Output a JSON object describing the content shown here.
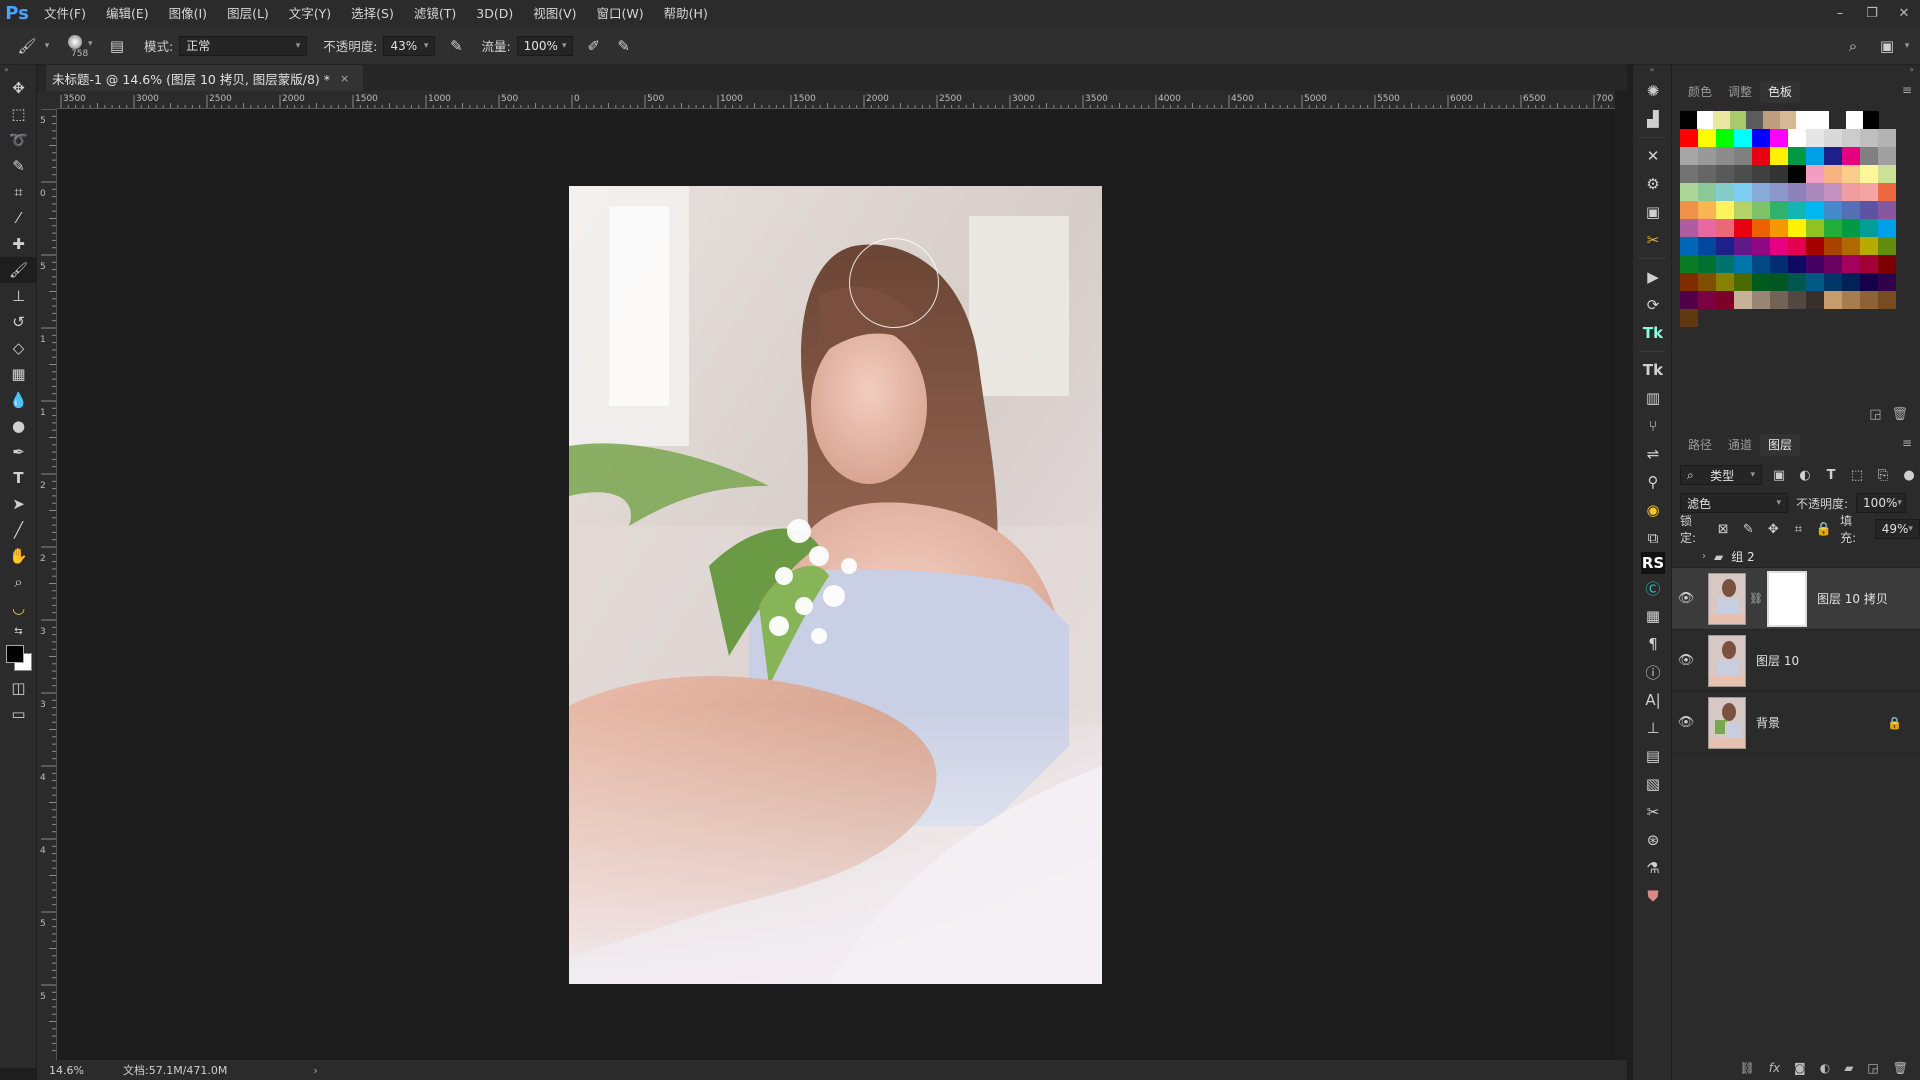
{
  "app": {
    "logo": "Ps"
  },
  "menu": [
    "文件(F)",
    "编辑(E)",
    "图像(I)",
    "图层(L)",
    "文字(Y)",
    "选择(S)",
    "滤镜(T)",
    "3D(D)",
    "视图(V)",
    "窗口(W)",
    "帮助(H)"
  ],
  "options": {
    "brush_size": "758",
    "mode_label": "模式:",
    "mode_value": "正常",
    "opacity_label": "不透明度:",
    "opacity_value": "43%",
    "flow_label": "流量:",
    "flow_value": "100%"
  },
  "document": {
    "tab_title": "未标题-1 @ 14.6% (图层 10 拷贝, 图层蒙版/8) *",
    "close": "×"
  },
  "ruler_h": [
    "3500",
    "3000",
    "2500",
    "2000",
    "1500",
    "1000",
    "500",
    "0",
    "500",
    "1000",
    "1500",
    "2000",
    "2500",
    "3000",
    "3500",
    "4000",
    "4500",
    "5000",
    "5500",
    "6000",
    "6500",
    "700"
  ],
  "ruler_v": [
    "5",
    "0",
    "5",
    "1",
    "1",
    "2",
    "2",
    "3",
    "3",
    "4",
    "4",
    "5",
    "5"
  ],
  "status": {
    "zoom": "14.6%",
    "doc_info": "文档:57.1M/471.0M",
    "chevron": "›"
  },
  "panels": {
    "top_tabs": [
      "颜色",
      "调整",
      "色板"
    ],
    "top_active": "色板",
    "layer_tabs": [
      "路径",
      "通道",
      "图层"
    ],
    "layer_active": "图层",
    "filter_kind": "类型",
    "blend_mode": "滤色",
    "opacity_label": "不透明度:",
    "opacity_value": "100%",
    "lock_label": "锁定:",
    "fill_label": "填充:",
    "fill_value": "49%",
    "group_name": "组 2",
    "layers": [
      {
        "name": "图层 10 拷贝",
        "has_mask": true,
        "selected": true
      },
      {
        "name": "图层 10",
        "has_mask": false,
        "selected": false
      },
      {
        "name": "背景",
        "has_mask": false,
        "selected": false,
        "locked": true
      }
    ]
  },
  "swatch_colors": [
    [
      "#000000",
      "#ffffff",
      "#e8e8a0",
      "#a8cc6c",
      "#5c5c5c",
      "#bd9f80",
      "#d6b896",
      "#ffffff",
      "#ffffff",
      "#2b2b2b",
      "#ffffff",
      "#000000",
      "#2b2b2b"
    ],
    [
      "#ff0000",
      "#ffff00",
      "#00ff00",
      "#00ffff",
      "#0000ff",
      "#ff00ff",
      "#ffffff",
      "#e6e6e6",
      "#d9d9d9",
      "#cccccc",
      "#bfbfbf",
      "#b3b3b3"
    ],
    [
      "#a6a6a6",
      "#999999",
      "#8c8c8c",
      "#808080",
      "#e60012",
      "#fff100",
      "#009944",
      "#00a0e9",
      "#1d2088",
      "#e4007f",
      "#808080",
      "#a0a0a0"
    ],
    [
      "#737373",
      "#666666",
      "#595959",
      "#4d4d4d",
      "#404040",
      "#333333",
      "#000000",
      "#f19ec2",
      "#f6b37f",
      "#facd89",
      "#fff799",
      "#cce198"
    ],
    [
      "#acd598",
      "#89c997",
      "#84ccc9",
      "#7ecef4",
      "#88abda",
      "#8c97cb",
      "#8f82bc",
      "#aa89bd",
      "#c490bf",
      "#f29c9f",
      "#f5a4a4",
      "#ec6941"
    ],
    [
      "#f19149",
      "#f8b551",
      "#fff45c",
      "#b3d465",
      "#80c269",
      "#32b16c",
      "#13b5b1",
      "#00b7ee",
      "#448aca",
      "#556fb5",
      "#5f52a0",
      "#8957a1"
    ],
    [
      "#ae5da1",
      "#ea68a2",
      "#eb6877",
      "#e60012",
      "#eb6100",
      "#f39800",
      "#fff100",
      "#8fc31f",
      "#22ac38",
      "#009944",
      "#009e96",
      "#00a0e9"
    ],
    [
      "#0068b7",
      "#00479d",
      "#1d2088",
      "#601986",
      "#920783",
      "#e4007f",
      "#e5004f",
      "#a40000",
      "#a84200",
      "#ac6a00",
      "#b7aa00",
      "#638c0b"
    ],
    [
      "#097c25",
      "#007130",
      "#00736d",
      "#0075a9",
      "#004986",
      "#002e73",
      "#100964",
      "#440062",
      "#6a005f",
      "#a4005b",
      "#a40035",
      "#7d0000"
    ],
    [
      "#7f2d00",
      "#7f4f00",
      "#878000",
      "#496a00",
      "#005c1e",
      "#005625",
      "#005752",
      "#005982",
      "#003567",
      "#002157",
      "#13004b",
      "#310048"
    ],
    [
      "#4f0046",
      "#7d0043",
      "#7e0026",
      "#c7b299",
      "#998675",
      "#736357",
      "#534741",
      "#37302a",
      "#c69c6d",
      "#a67c52",
      "#8c6239",
      "#754c24"
    ],
    [
      "#603913"
    ]
  ]
}
